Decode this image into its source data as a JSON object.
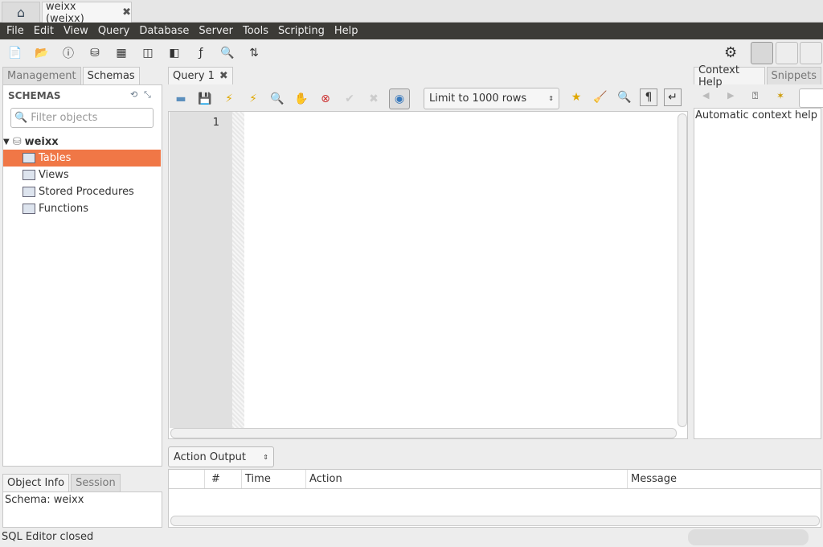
{
  "window": {
    "connection_tab": "weixx (weixx)",
    "home_icon": "home-icon",
    "close_icon": "close-icon"
  },
  "menu": [
    "File",
    "Edit",
    "View",
    "Query",
    "Database",
    "Server",
    "Tools",
    "Scripting",
    "Help"
  ],
  "main_toolbar": [
    "new-sql-tab-icon",
    "open-sql-script-icon",
    "schema-inspector-icon",
    "create-schema-icon",
    "create-table-icon",
    "create-view-icon",
    "create-procedure-icon",
    "create-function-icon",
    "search-table-data-icon",
    "reconnect-icon"
  ],
  "left": {
    "tabs": [
      "Management",
      "Schemas"
    ],
    "active_tab": "Schemas",
    "header": "SCHEMAS",
    "filter_placeholder": "Filter objects",
    "schema": "weixx",
    "items": [
      "Tables",
      "Views",
      "Stored Procedures",
      "Functions"
    ],
    "selected": "Tables"
  },
  "object_info": {
    "tabs": [
      "Object Info",
      "Session"
    ],
    "text": "Schema: weixx"
  },
  "editor": {
    "tab": "Query 1",
    "limit": "Limit to 1000 rows",
    "line_numbers": [
      "1"
    ]
  },
  "output": {
    "selector": "Action Output",
    "columns": [
      "",
      "#",
      "Time",
      "Action",
      "Message"
    ]
  },
  "right": {
    "tabs": [
      "Context Help",
      "Snippets"
    ],
    "text": "Automatic context help is"
  },
  "status": {
    "text": "SQL Editor closed"
  },
  "colors": {
    "menubar": "#3c3b37",
    "selection": "#f07746"
  }
}
